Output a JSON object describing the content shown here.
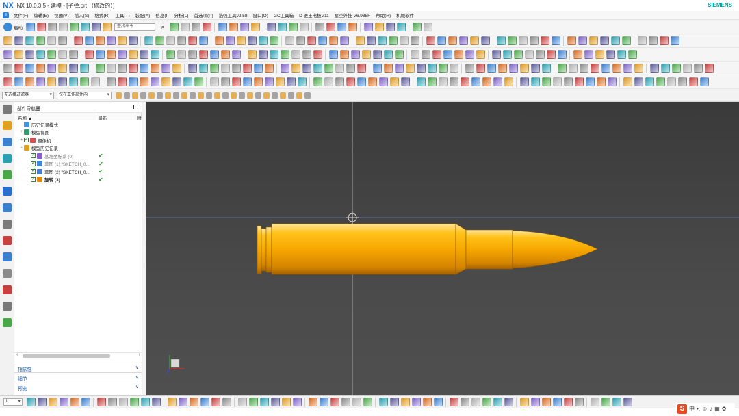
{
  "app": {
    "logo": "NX",
    "title": "NX 10.0.3.5 - 建模 - [子弹.prt （修改的）]",
    "brand": "SIEMENS"
  },
  "menu": {
    "items": [
      "文件(F)",
      "编辑(E)",
      "视图(V)",
      "插入(S)",
      "格式(R)",
      "工具(T)",
      "装配(A)",
      "信息(I)",
      "分析(L)",
      "首选项(P)",
      "浩强工具v2.58",
      "窗口(O)",
      "GC工具箱",
      "D 进王电极V11",
      "星空外挂 V6.935F",
      "帮助(H)",
      "机械软件"
    ]
  },
  "toolbar": {
    "start_label": "启动",
    "search_placeholder": "查找命令"
  },
  "filterbar": {
    "selection_filter": "无选择过滤器",
    "scope": "仅在工作部件内"
  },
  "navigator": {
    "title": "部件导航器",
    "col_name": "名称",
    "col_latest": "最新",
    "col_extra": "附",
    "rows": [
      {
        "label": "历史记录模式",
        "expander": "",
        "checked": false,
        "latest": false,
        "muted": false,
        "bold": false
      },
      {
        "label": "模型视图",
        "expander": "+",
        "checked": false,
        "latest": false,
        "muted": false,
        "bold": false
      },
      {
        "label": "摄像机",
        "expander": "+",
        "checked": true,
        "latest": false,
        "muted": false,
        "bold": false
      },
      {
        "label": "模型历史记录",
        "expander": "−",
        "checked": false,
        "latest": false,
        "muted": false,
        "bold": false
      },
      {
        "label": "基准坐标系 (0)",
        "expander": "",
        "checked": true,
        "latest": true,
        "muted": true,
        "bold": false
      },
      {
        "label": "草图 (1) \"SKETCH_0...",
        "expander": "",
        "checked": true,
        "latest": true,
        "muted": true,
        "bold": false
      },
      {
        "label": "草图 (2) \"SKETCH_0...",
        "expander": "",
        "checked": true,
        "latest": true,
        "muted": false,
        "bold": false
      },
      {
        "label": "旋转 (3)",
        "expander": "",
        "checked": true,
        "latest": true,
        "muted": false,
        "bold": true
      }
    ],
    "sections": [
      "相依性",
      "细节",
      "预览"
    ]
  },
  "bottombar": {
    "value": "1"
  },
  "ime": {
    "logo": "S",
    "lang": "中"
  },
  "colors": {
    "accent": "#1b73c9",
    "bullet": "#f5a800",
    "viewport_bg": "#404040"
  }
}
